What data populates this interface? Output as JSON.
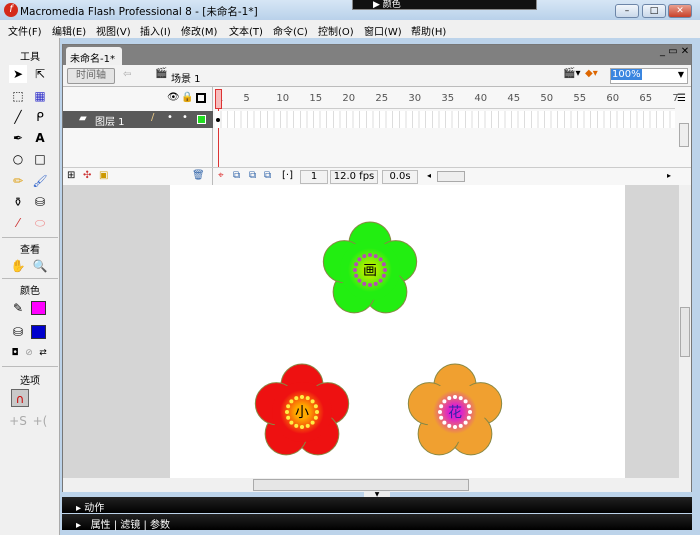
{
  "window": {
    "title": "Macromedia Flash Professional 8 - [未命名-1*]",
    "logo": "f",
    "minimize": "–",
    "maximize": "□",
    "close": "✕"
  },
  "overlay_panel": {
    "label": "▶ 颜色"
  },
  "menu": [
    "文件(F)",
    "编辑(E)",
    "视图(V)",
    "插入(I)",
    "修改(M)",
    "文本(T)",
    "命令(C)",
    "控制(O)",
    "窗口(W)",
    "帮助(H)"
  ],
  "toolbox": {
    "title": "工具",
    "view_title": "查看",
    "colors_title": "颜色",
    "options_title": "选项",
    "stroke_color": "#ff00ff",
    "fill_color": "#0000cc",
    "tools": [
      "arrow-icon",
      "subselect-icon",
      "free-transform-icon",
      "gradient-transform-icon",
      "line-icon",
      "lasso-icon",
      "pen-icon",
      "text-icon",
      "oval-icon",
      "rectangle-icon",
      "pencil-icon",
      "brush-icon",
      "ink-bottle-icon",
      "paint-bucket-icon",
      "eyedropper-icon",
      "eraser-icon"
    ]
  },
  "document": {
    "tab": "未命名-1*",
    "timeline_button": "时间轴",
    "scene": "场景 1",
    "zoom": "100%"
  },
  "timeline": {
    "ruler": [
      "1",
      "5",
      "10",
      "15",
      "20",
      "25",
      "30",
      "35",
      "40",
      "45",
      "50",
      "55",
      "60",
      "65",
      "7"
    ],
    "layer_name": "图层 1",
    "current_frame": "1",
    "fps": "12.0 fps",
    "elapsed": "0.0s"
  },
  "stage": {
    "flowers": [
      {
        "char": "画",
        "petal": "#22ee11",
        "center": "#aaee00",
        "dots": "#b44fb4",
        "text_color": "#000"
      },
      {
        "char": "小",
        "petal": "#ee1111",
        "center": "#ffaa00",
        "dots": "#ffee44",
        "text_color": "#000"
      },
      {
        "char": "花",
        "petal": "#f0a030",
        "center": "#dd22cc",
        "dots": "#ffffff",
        "text_color": "#3322aa"
      }
    ]
  },
  "panels": {
    "actions": "动作",
    "properties": "属性",
    "filters": "滤镜",
    "parameters": "参数"
  }
}
